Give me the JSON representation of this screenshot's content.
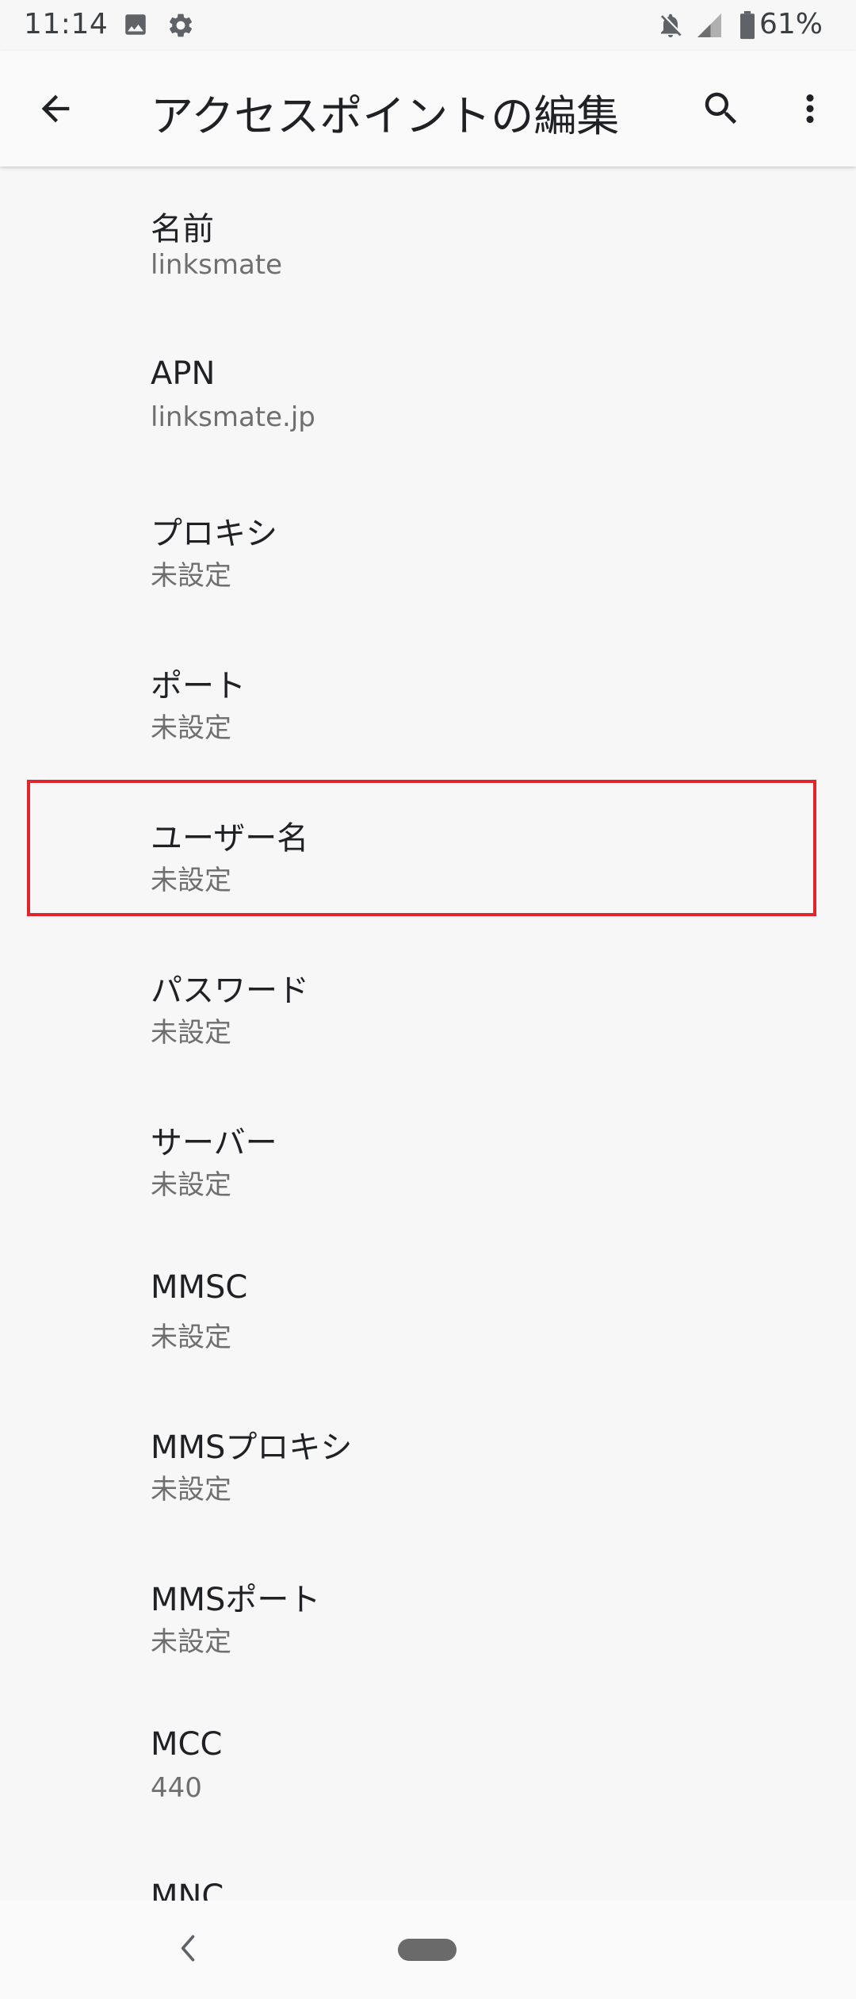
{
  "status_bar": {
    "time": "11:14",
    "battery": "61%",
    "icons": [
      "image-icon",
      "gear-icon",
      "bell-off-icon",
      "signal-icon",
      "battery-icon"
    ]
  },
  "app_bar": {
    "title": "アクセスポイントの編集",
    "icons": [
      "back-arrow-icon",
      "search-icon",
      "more-vert-icon"
    ]
  },
  "settings": [
    {
      "title": "名前",
      "summary": "linksmate"
    },
    {
      "title": "APN",
      "summary": "linksmate.jp"
    },
    {
      "title": "プロキシ",
      "summary": "未設定"
    },
    {
      "title": "ポート",
      "summary": "未設定"
    },
    {
      "title": "ユーザー名",
      "summary": "未設定"
    },
    {
      "title": "パスワード",
      "summary": "未設定"
    },
    {
      "title": "サーバー",
      "summary": "未設定"
    },
    {
      "title": "MMSC",
      "summary": "未設定"
    },
    {
      "title": "MMSプロキシ",
      "summary": "未設定"
    },
    {
      "title": "MMSポート",
      "summary": "未設定"
    },
    {
      "title": "MCC",
      "summary": "440"
    },
    {
      "title": "MNC",
      "summary": ""
    }
  ],
  "highlighted_item": "ユーザー名",
  "colors": {
    "background": "#f7f7f7",
    "highlight_border": "#e0252f",
    "title_text": "#202124",
    "summary_text": "#6f6f6f"
  },
  "nav_bar": {
    "icons": [
      "nav-back-icon",
      "home-pill-icon"
    ]
  }
}
